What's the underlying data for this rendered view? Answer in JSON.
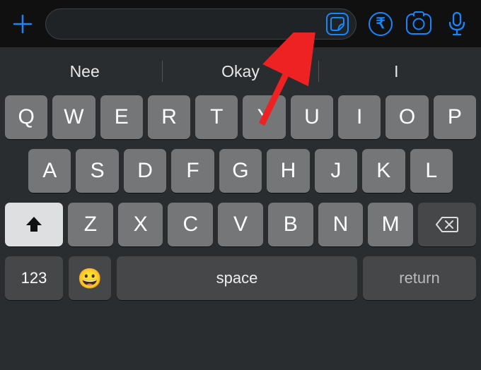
{
  "topbar": {
    "sticker_icon": "sticker",
    "rupee_symbol": "₹"
  },
  "suggestions": [
    "Nee",
    "Okay",
    "I"
  ],
  "keyboard": {
    "row1": [
      "Q",
      "W",
      "E",
      "R",
      "T",
      "Y",
      "U",
      "I",
      "O",
      "P"
    ],
    "row2": [
      "A",
      "S",
      "D",
      "F",
      "G",
      "H",
      "J",
      "K",
      "L"
    ],
    "row3": [
      "Z",
      "X",
      "C",
      "V",
      "B",
      "N",
      "M"
    ],
    "numbers_label": "123",
    "space_label": "space",
    "return_label": "return"
  }
}
